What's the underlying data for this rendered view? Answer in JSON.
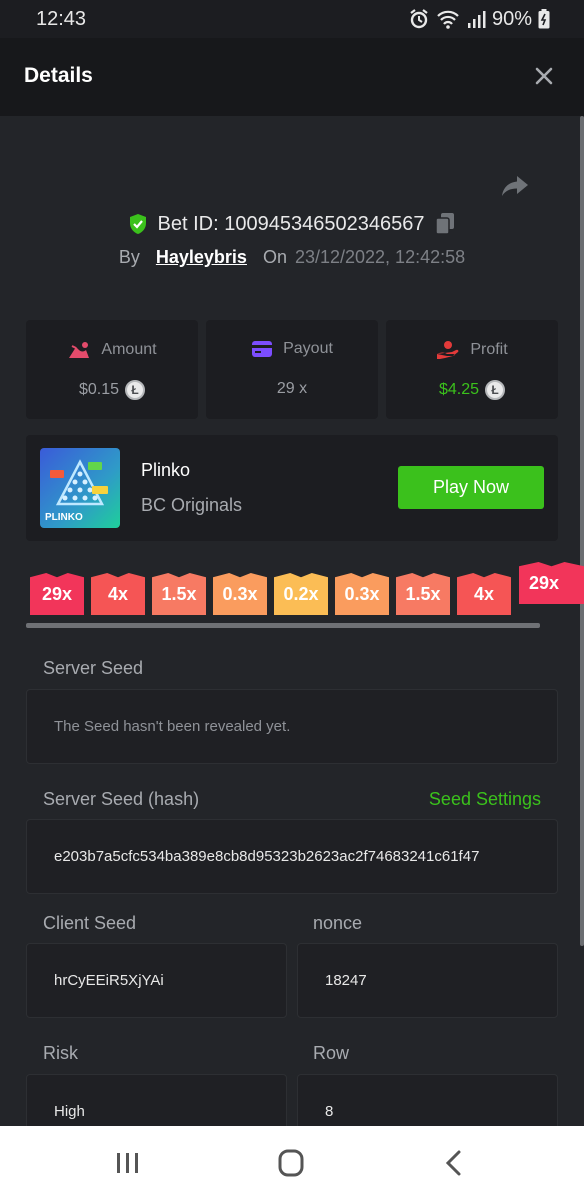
{
  "status": {
    "time": "12:43",
    "battery": "90%"
  },
  "header": {
    "title": "Details"
  },
  "bet": {
    "id_label": "Bet ID: 100945346502346567",
    "by_label": "By",
    "user": "Hayleybris",
    "on_label": "On",
    "date": "23/12/2022, 12:42:58"
  },
  "stats": {
    "amount": {
      "label": "Amount",
      "value": "$0.15",
      "color": "#e34b6b"
    },
    "payout": {
      "label": "Payout",
      "value": "29 x",
      "color": "#7c4dff"
    },
    "profit": {
      "label": "Profit",
      "value": "$4.25",
      "color": "#e33a3a",
      "value_color": "#3bc11c"
    }
  },
  "game": {
    "name": "Plinko",
    "provider": "BC Originals",
    "play_label": "Play Now",
    "thumb_text": "PLINKO"
  },
  "multipliers": [
    {
      "label": "29x",
      "color": "#f2355a"
    },
    {
      "label": "4x",
      "color": "#f55555"
    },
    {
      "label": "1.5x",
      "color": "#f77a63"
    },
    {
      "label": "0.3x",
      "color": "#fa9c5e"
    },
    {
      "label": "0.2x",
      "color": "#fbbd55"
    },
    {
      "label": "0.3x",
      "color": "#fa9c5e"
    },
    {
      "label": "1.5x",
      "color": "#f77a63"
    },
    {
      "label": "4x",
      "color": "#f55555"
    },
    {
      "label": "29x",
      "color": "#f2355a"
    }
  ],
  "seeds": {
    "server_seed_label": "Server Seed",
    "server_seed_value": "The Seed hasn't been revealed yet.",
    "server_hash_label": "Server Seed (hash)",
    "seed_settings_label": "Seed Settings",
    "server_hash_value": "e203b7a5cfc534ba389e8cb8d95323b2623ac2f74683241c61f47",
    "client_seed_label": "Client Seed",
    "client_seed_value": "hrCyEEiR5XjYAi",
    "nonce_label": "nonce",
    "nonce_value": "18247",
    "risk_label": "Risk",
    "risk_value": "High",
    "row_label": "Row",
    "row_value": "8"
  }
}
